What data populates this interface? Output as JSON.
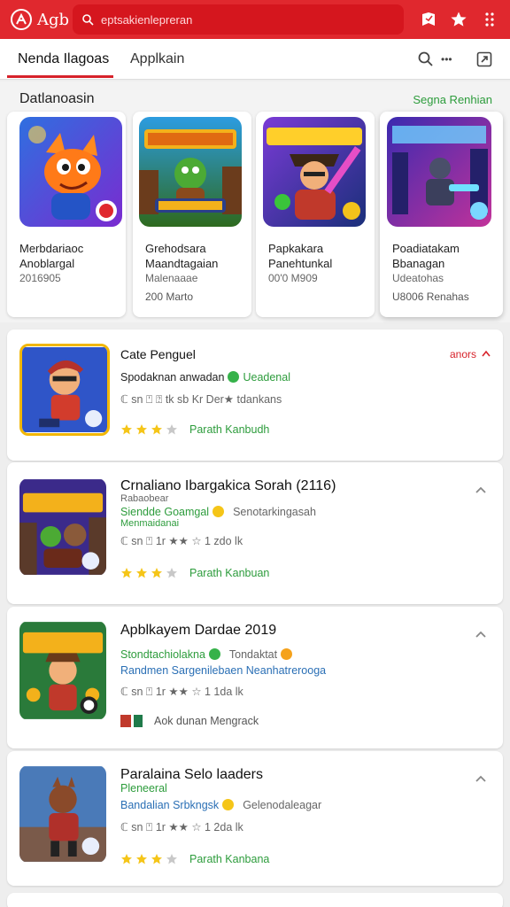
{
  "app": {
    "logo_text": "Agb",
    "search_placeholder": "eptsakienlepreran"
  },
  "tabs": [
    {
      "label": "Nenda Ilagoas"
    },
    {
      "label": "Applkain"
    }
  ],
  "toolbar": {
    "more_label": "•••"
  },
  "section": {
    "title": "Datlanoasin",
    "more_label": "Segna Renhian",
    "cards": [
      {
        "title": "Merbdariaoc Anoblargal",
        "meta": "2016905",
        "meta2": ""
      },
      {
        "title": "Grehodsara Maandtagaian",
        "meta": "Malenaaae",
        "meta2": "200 Marto"
      },
      {
        "title": "Papkakara Panehtunkal",
        "meta": "00'0 M909",
        "meta2": ""
      },
      {
        "title": "Poadiatakam Bbanagan",
        "meta": "Udeatohas",
        "meta2": "U8006 Renahas"
      }
    ]
  },
  "list": [
    {
      "title": "Cate Penguel",
      "line1_a": "Spodaknan anwadan",
      "line1_b": "Ueadenal",
      "line2": "ℂ sn  ⍞ ⍰ tk sb Kr Der★ tdankans",
      "rating_label": "Parath Kanbudh",
      "stars": 3,
      "expand_label": "anors"
    },
    {
      "title": "Crnaliano Ibargakica Sorah (2116)",
      "line0": "Rabaobear",
      "line1_a": "Siendde Goamgal",
      "line1_b": "Senotarkingasah",
      "line1_c": "Menmaidanai",
      "line2": "ℂ sn  ⍞ 1r  ★★  ☆  1 zdo lk",
      "rating_label": "Parath Kanbuan",
      "stars": 3
    },
    {
      "title": "Apblkayem Dardae 2019",
      "line1_a": "Stondtachiolakna",
      "line1_b": "Tondaktat",
      "line1_c": "Randmen Sargenilebaen Neanhatrerooga",
      "line2": "ℂ sn  ⍞ 1r  ★★  ☆  1 1da lk",
      "rating_label": "Aok dunan Mengrack"
    },
    {
      "title": "Paralaina Selo laaders",
      "line0": "Pleneeral",
      "line1_a": "Bandalian Srbkngsk",
      "line1_b": "Gelenodaleagar",
      "line2": "ℂ sn  ⍞ 1r  ★★  ☆  1 2da lk",
      "rating_label": "Parath Kanbana",
      "stars": 3
    }
  ],
  "colors": {
    "brand_red": "#e0282e",
    "accent_green": "#2d9c3c",
    "star_yellow": "#f5c518"
  }
}
